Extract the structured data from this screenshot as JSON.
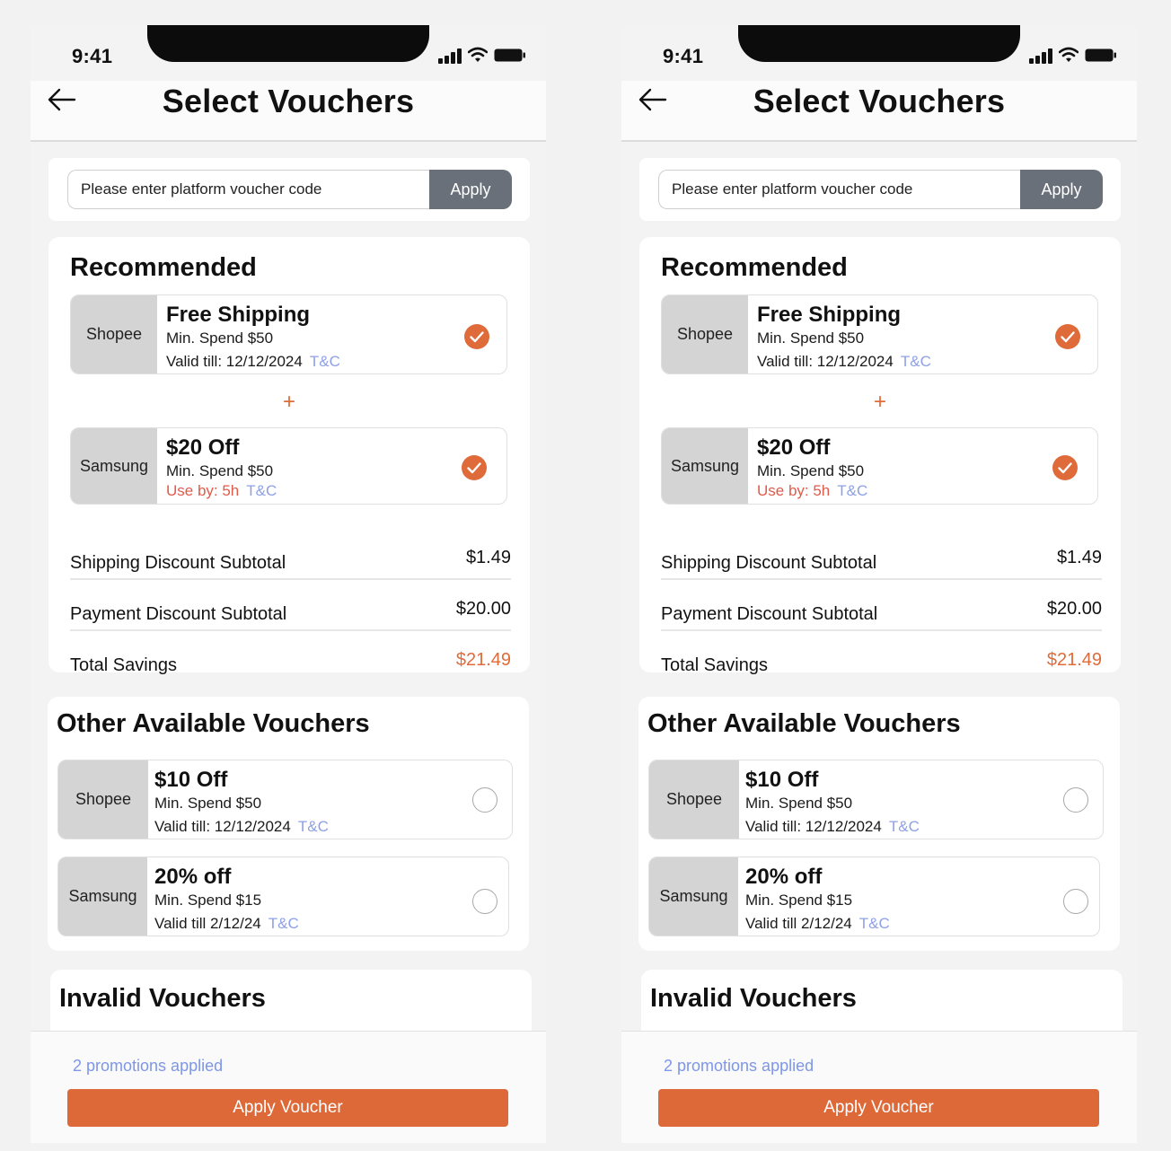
{
  "statusbar": {
    "time": "9:41"
  },
  "header": {
    "title": "Select Vouchers"
  },
  "code": {
    "placeholder": "Please enter platform voucher code",
    "apply_label": "Apply"
  },
  "recommended": {
    "title": "Recommended",
    "plus": "+",
    "vouchers": [
      {
        "brand": "Shopee",
        "title": "Free Shipping",
        "line1": "Min. Spend $50",
        "line2": "Valid till: 12/12/2024",
        "tc": "T&C",
        "selected": true
      },
      {
        "brand": "Samsung",
        "title": "$20 Off",
        "line1": "Min. Spend $50",
        "line2": "Use by: 5h",
        "tc": "T&C",
        "selected": true
      }
    ],
    "summary": [
      {
        "label": "Shipping Discount Subtotal",
        "value": "$1.49"
      },
      {
        "label": "Payment Discount Subtotal",
        "value": "$20.00"
      },
      {
        "label": "Total Savings",
        "value": "$21.49"
      }
    ]
  },
  "other": {
    "title": "Other Available Vouchers",
    "vouchers": [
      {
        "brand": "Shopee",
        "title": "$10 Off",
        "line1": "Min. Spend $50",
        "line2": "Valid till: 12/12/2024",
        "tc": "T&C",
        "selected": false
      },
      {
        "brand": "Samsung",
        "title": "20% off",
        "line1": "Min. Spend $15",
        "line2": "Valid till 2/12/24",
        "tc": "T&C",
        "selected": false
      }
    ]
  },
  "invalid": {
    "title": "Invalid Vouchers"
  },
  "footer": {
    "promotions": "2 promotions applied",
    "button_label": "Apply Voucher"
  },
  "colors": {
    "accent": "#dd6838",
    "link": "#8ea0e6",
    "warning": "#e05a4a",
    "apply_button": "#69707a"
  }
}
